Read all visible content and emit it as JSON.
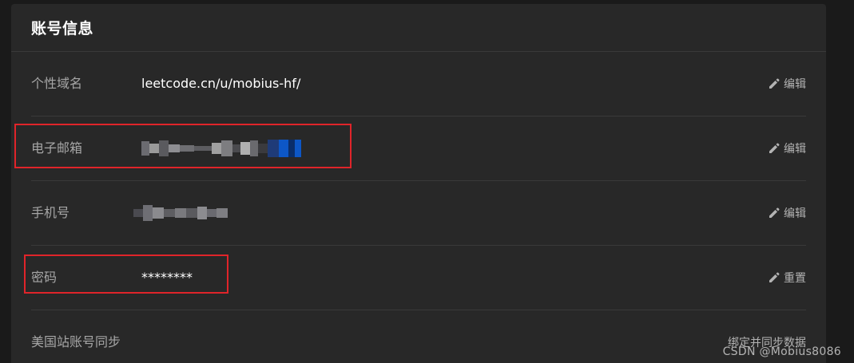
{
  "panel": {
    "title": "账号信息"
  },
  "rows": [
    {
      "label": "个性域名",
      "value": "leetcode.cn/u/mobius-hf/",
      "action": "编辑"
    },
    {
      "label": "电子邮箱",
      "value": "",
      "action": "编辑"
    },
    {
      "label": "手机号",
      "value": "",
      "action": "编辑"
    },
    {
      "label": "密码",
      "value": "********",
      "action": "重置"
    },
    {
      "label": "美国站账号同步",
      "value": "",
      "action": "绑定并同步数据"
    }
  ],
  "icons": {
    "edit": "pencil-icon"
  },
  "colors": {
    "highlight": "#e0242a",
    "background": "#282828"
  },
  "watermark": "CSDN @Mobius8086"
}
